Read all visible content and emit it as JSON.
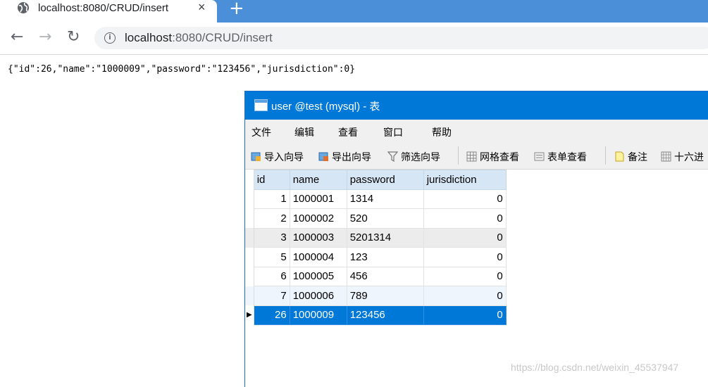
{
  "browser": {
    "tab_title": "localhost:8080/CRUD/insert",
    "tab_close": "×",
    "new_tab": "+",
    "back": "←",
    "forward": "→",
    "reload": "↻",
    "url_host": "localhost",
    "url_path": ":8080/CRUD/insert",
    "info": "i"
  },
  "page": {
    "response_json": "{\"id\":26,\"name\":\"1000009\",\"password\":\"123456\",\"jurisdiction\":0}"
  },
  "navicat": {
    "window_title": "user @test (mysql) - 表",
    "menu": [
      "文件",
      "编辑",
      "查看",
      "窗口",
      "帮助"
    ],
    "toolbar": {
      "import": "导入向导",
      "export": "导出向导",
      "filter": "筛选向导",
      "grid_view": "网格查看",
      "form_view": "表单查看",
      "memo": "备注",
      "hex": "十六进"
    },
    "columns": [
      "id",
      "name",
      "password",
      "jurisdiction"
    ],
    "row_marker": "▶",
    "rows": [
      {
        "id": "1",
        "name": "1000001",
        "password": "1314",
        "jurisdiction": "0"
      },
      {
        "id": "2",
        "name": "1000002",
        "password": "520",
        "jurisdiction": "0"
      },
      {
        "id": "3",
        "name": "1000003",
        "password": "5201314",
        "jurisdiction": "0"
      },
      {
        "id": "5",
        "name": "1000004",
        "password": "123",
        "jurisdiction": "0"
      },
      {
        "id": "6",
        "name": "1000005",
        "password": "456",
        "jurisdiction": "0"
      },
      {
        "id": "7",
        "name": "1000006",
        "password": "789",
        "jurisdiction": "0"
      },
      {
        "id": "26",
        "name": "1000009",
        "password": "123456",
        "jurisdiction": "0"
      }
    ]
  },
  "watermark": "https://blog.csdn.net/weixin_45537947",
  "colors": {
    "tabbar": "#4a8fd8",
    "titlebar": "#0078d7",
    "selection": "#0078d7",
    "header": "#d7e6f5"
  }
}
